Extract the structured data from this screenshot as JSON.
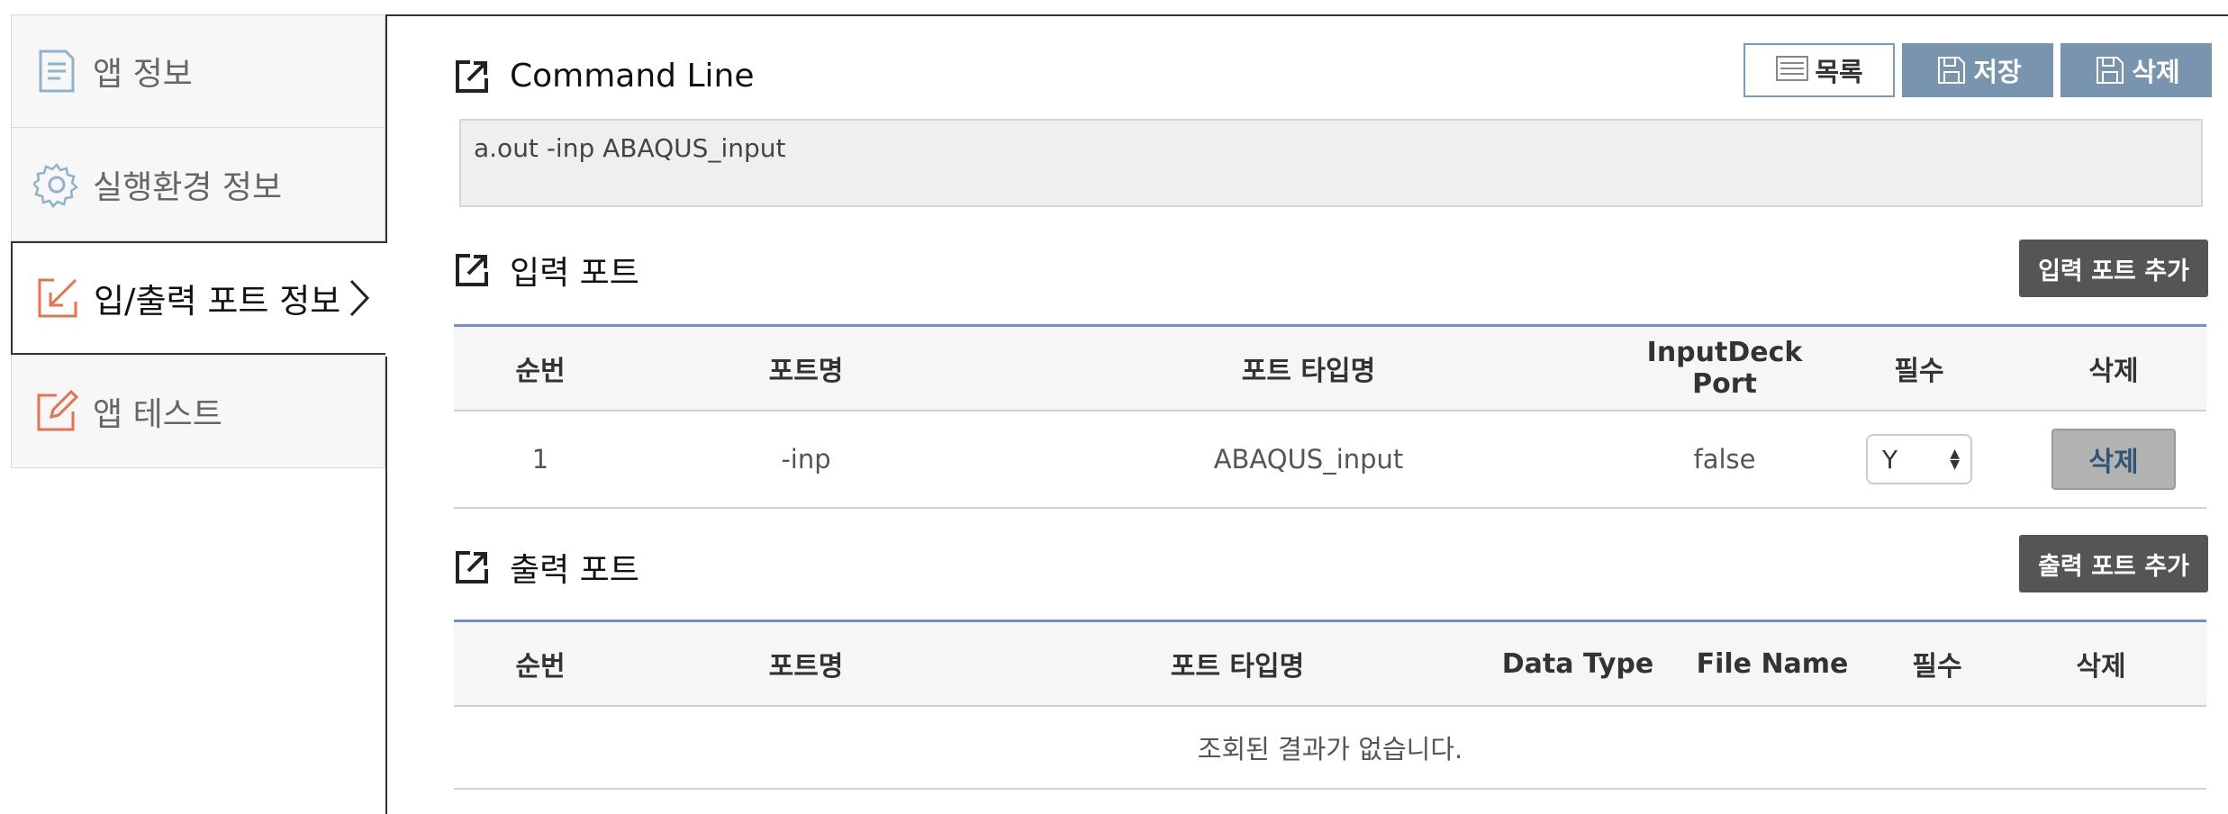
{
  "sidebar": {
    "items": [
      {
        "label": "앱 정보",
        "icon": "document-icon",
        "active": false
      },
      {
        "label": "실행환경 정보",
        "icon": "gear-icon",
        "active": false
      },
      {
        "label": "입/출력 포트 정보",
        "icon": "import-icon",
        "active": true
      },
      {
        "label": "앱 테스트",
        "icon": "edit-icon",
        "active": false
      }
    ]
  },
  "toolbar": {
    "list_label": "목록",
    "save_label": "저장",
    "delete_label": "삭제"
  },
  "command_line": {
    "title": "Command Line",
    "value": "a.out -inp ABAQUS_input"
  },
  "input_ports": {
    "title": "입력 포트",
    "add_button": "입력 포트 추가",
    "columns": [
      "순번",
      "포트명",
      "포트 타입명",
      "InputDeck Port",
      "필수",
      "삭제"
    ],
    "rows": [
      {
        "no": "1",
        "name": "-inp",
        "type": "ABAQUS_input",
        "inputdeck": "false",
        "required": "Y",
        "delete": "삭제"
      }
    ]
  },
  "output_ports": {
    "title": "출력 포트",
    "add_button": "출력 포트 추가",
    "columns": [
      "순번",
      "포트명",
      "포트 타입명",
      "Data Type",
      "File Name",
      "필수",
      "삭제"
    ],
    "empty_message": "조회된 결과가 없습니다."
  },
  "colors": {
    "accent": "#7994ad",
    "table_top_border": "#6f8fc8",
    "sidebar_icon": "#e8734a",
    "sidebar_icon_muted": "#8fb3cc"
  }
}
